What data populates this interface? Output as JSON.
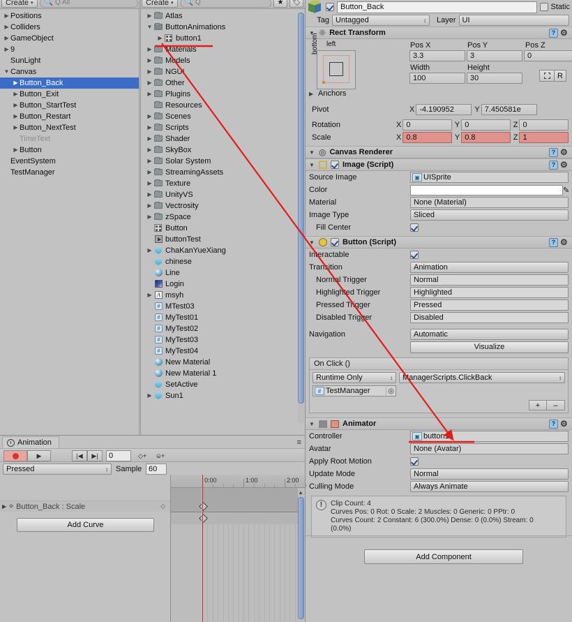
{
  "hierarchy": {
    "toolbar": {
      "create_label": "Create",
      "create_caret": "▾",
      "search_placeholder": "Q All"
    },
    "items": [
      {
        "label": "Positions",
        "depth": 0,
        "arrow": "closed",
        "style": "normal"
      },
      {
        "label": "Colliders",
        "depth": 0,
        "arrow": "closed",
        "style": "normal"
      },
      {
        "label": "GameObject",
        "depth": 0,
        "arrow": "closed",
        "style": "normal"
      },
      {
        "label": "9",
        "depth": 0,
        "arrow": "closed",
        "style": "normal"
      },
      {
        "label": "SunLight",
        "depth": 0,
        "arrow": "none",
        "style": "normal"
      },
      {
        "label": "Canvas",
        "depth": 0,
        "arrow": "open",
        "style": "normal"
      },
      {
        "label": "Button_Back",
        "depth": 1,
        "arrow": "closed",
        "style": "selected"
      },
      {
        "label": "Button_Exit",
        "depth": 1,
        "arrow": "closed",
        "style": "normal"
      },
      {
        "label": "Button_StartTest",
        "depth": 1,
        "arrow": "closed",
        "style": "normal"
      },
      {
        "label": "Button_Restart",
        "depth": 1,
        "arrow": "closed",
        "style": "normal"
      },
      {
        "label": "Button_NextTest",
        "depth": 1,
        "arrow": "closed",
        "style": "normal"
      },
      {
        "label": "TimeText",
        "depth": 1,
        "arrow": "none",
        "style": "dim"
      },
      {
        "label": "Button",
        "depth": 1,
        "arrow": "closed",
        "style": "normal"
      },
      {
        "label": "EventSystem",
        "depth": 0,
        "arrow": "none",
        "style": "normal"
      },
      {
        "label": "TestManager",
        "depth": 0,
        "arrow": "none",
        "style": "normal"
      }
    ]
  },
  "project": {
    "toolbar": {
      "create_label": "Create",
      "create_caret": "▾",
      "search_placeholder": "Q"
    },
    "items": [
      {
        "label": "Atlas",
        "depth": 0,
        "arrow": "closed",
        "icon": "folder"
      },
      {
        "label": "ButtonAnimations",
        "depth": 0,
        "arrow": "open",
        "icon": "folder-open"
      },
      {
        "label": "button1",
        "depth": 1,
        "arrow": "closed",
        "icon": "animator"
      },
      {
        "label": "Materials",
        "depth": 0,
        "arrow": "closed",
        "icon": "folder"
      },
      {
        "label": "Models",
        "depth": 0,
        "arrow": "closed",
        "icon": "folder"
      },
      {
        "label": "NGUI",
        "depth": 0,
        "arrow": "closed",
        "icon": "folder"
      },
      {
        "label": "Other",
        "depth": 0,
        "arrow": "closed",
        "icon": "folder"
      },
      {
        "label": "Plugins",
        "depth": 0,
        "arrow": "closed",
        "icon": "folder"
      },
      {
        "label": "Resources",
        "depth": 0,
        "arrow": "none",
        "icon": "folder"
      },
      {
        "label": "Scenes",
        "depth": 0,
        "arrow": "closed",
        "icon": "folder"
      },
      {
        "label": "Scripts",
        "depth": 0,
        "arrow": "closed",
        "icon": "folder"
      },
      {
        "label": "Shader",
        "depth": 0,
        "arrow": "closed",
        "icon": "folder"
      },
      {
        "label": "SkyBox",
        "depth": 0,
        "arrow": "closed",
        "icon": "folder"
      },
      {
        "label": "Solar System",
        "depth": 0,
        "arrow": "closed",
        "icon": "folder"
      },
      {
        "label": "StreamingAssets",
        "depth": 0,
        "arrow": "closed",
        "icon": "folder"
      },
      {
        "label": "Texture",
        "depth": 0,
        "arrow": "closed",
        "icon": "folder"
      },
      {
        "label": "UnityVS",
        "depth": 0,
        "arrow": "closed",
        "icon": "folder"
      },
      {
        "label": "Vectrosity",
        "depth": 0,
        "arrow": "closed",
        "icon": "folder"
      },
      {
        "label": "zSpace",
        "depth": 0,
        "arrow": "closed",
        "icon": "folder"
      },
      {
        "label": "Button",
        "depth": 0,
        "arrow": "none",
        "icon": "animator"
      },
      {
        "label": "buttonTest",
        "depth": 0,
        "arrow": "none",
        "icon": "play"
      },
      {
        "label": "ChaKanYueXiang",
        "depth": 0,
        "arrow": "closed",
        "icon": "prefab"
      },
      {
        "label": "chinese",
        "depth": 0,
        "arrow": "none",
        "icon": "prefab"
      },
      {
        "label": "Line",
        "depth": 0,
        "arrow": "none",
        "icon": "material"
      },
      {
        "label": "Login",
        "depth": 0,
        "arrow": "none",
        "icon": "texture"
      },
      {
        "label": "msyh",
        "depth": 0,
        "arrow": "closed",
        "icon": "font"
      },
      {
        "label": "MTest03",
        "depth": 0,
        "arrow": "none",
        "icon": "script"
      },
      {
        "label": "MyTest01",
        "depth": 0,
        "arrow": "none",
        "icon": "script"
      },
      {
        "label": "MyTest02",
        "depth": 0,
        "arrow": "none",
        "icon": "script"
      },
      {
        "label": "MyTest03",
        "depth": 0,
        "arrow": "none",
        "icon": "script"
      },
      {
        "label": "MyTest04",
        "depth": 0,
        "arrow": "none",
        "icon": "script"
      },
      {
        "label": "New Material",
        "depth": 0,
        "arrow": "none",
        "icon": "material"
      },
      {
        "label": "New Material 1",
        "depth": 0,
        "arrow": "none",
        "icon": "material"
      },
      {
        "label": "SetActive",
        "depth": 0,
        "arrow": "none",
        "icon": "prefab"
      },
      {
        "label": "Sun1",
        "depth": 0,
        "arrow": "closed",
        "icon": "prefab"
      }
    ]
  },
  "inspector": {
    "object_name": "Button_Back",
    "static_label": "Static",
    "tag_label": "Tag",
    "tag_value": "Untagged",
    "layer_label": "Layer",
    "layer_value": "UI",
    "rect_transform": {
      "title": "Rect Transform",
      "anchor_preset_top": "left",
      "anchor_preset_side": "bottom",
      "pos_x_label": "Pos X",
      "pos_x": "3.3",
      "pos_y_label": "Pos Y",
      "pos_y": "3",
      "pos_z_label": "Pos Z",
      "pos_z": "0",
      "width_label": "Width",
      "width": "100",
      "height_label": "Height",
      "height": "30",
      "blueprint_label": "R",
      "anchors_label": "Anchors",
      "pivot_label": "Pivot",
      "pivot_x": "-4.190952",
      "pivot_y": "7.450581e",
      "rotation_label": "Rotation",
      "rot_x": "0",
      "rot_y": "0",
      "rot_z": "0",
      "scale_label": "Scale",
      "scale_x": "0.8",
      "scale_y": "0.8",
      "scale_z": "1",
      "axis_x": "X",
      "axis_y": "Y",
      "axis_z": "Z"
    },
    "canvas_renderer": {
      "title": "Canvas Renderer"
    },
    "image_script": {
      "title": "Image (Script)",
      "source_image_label": "Source Image",
      "source_image": "UISprite",
      "color_label": "Color",
      "color_value": "#FFFFFF",
      "material_label": "Material",
      "material": "None (Material)",
      "image_type_label": "Image Type",
      "image_type": "Sliced",
      "fill_center_label": "Fill Center",
      "fill_center": true
    },
    "button_script": {
      "title": "Button (Script)",
      "interactable_label": "Interactable",
      "interactable": true,
      "transition_label": "Transition",
      "transition": "Animation",
      "normal_trigger_label": "Normal Trigger",
      "normal_trigger": "Normal",
      "highlighted_trigger_label": "Highlighted Trigger",
      "highlighted_trigger": "Highlighted",
      "pressed_trigger_label": "Pressed Trigger",
      "pressed_trigger": "Pressed",
      "disabled_trigger_label": "Disabled Trigger",
      "disabled_trigger": "Disabled",
      "navigation_label": "Navigation",
      "navigation": "Automatic",
      "visualize_label": "Visualize",
      "onclick_label": "On Click ()",
      "onclick_mode": "Runtime Only",
      "onclick_function": "ManagerScripts.ClickBack",
      "onclick_object": "TestManager",
      "add_btn": "+",
      "remove_btn": "–"
    },
    "animator": {
      "title": "Animator",
      "controller_label": "Controller",
      "controller": "button1",
      "avatar_label": "Avatar",
      "avatar": "None (Avatar)",
      "apply_root_motion_label": "Apply Root Motion",
      "apply_root_motion": true,
      "update_mode_label": "Update Mode",
      "update_mode": "Normal",
      "culling_mode_label": "Culling Mode",
      "culling_mode": "Always Animate",
      "info_line1": "Clip Count: 4",
      "info_line2": "Curves Pos: 0 Rot: 0 Scale: 2 Muscles: 0 Generic: 0 PPtr: 0",
      "info_line3": "Curves Count: 2 Constant: 6 (300.0%) Dense: 0 (0.0%) Stream: 0",
      "info_line4": "(0.0%)"
    },
    "add_component_label": "Add Component"
  },
  "animation_window": {
    "tab_label": "Animation",
    "menu_glyph": "≡",
    "record_title": "record",
    "play_title": "play",
    "prev_key": "|◀",
    "next_key": "▶|",
    "frame_value": "0",
    "add_keyframe": "◇+",
    "add_event": "⎉+",
    "clip_name": "Pressed",
    "sample_label": "Sample",
    "sample_value": "60",
    "curve_label": "Button_Back : Scale",
    "add_curve_label": "Add Curve",
    "ruler_ticks": [
      "0:00",
      "1:00",
      "2:00"
    ]
  },
  "annotation": {
    "color": "#e41b1b",
    "from_label": "button1",
    "to_label": "button1"
  }
}
